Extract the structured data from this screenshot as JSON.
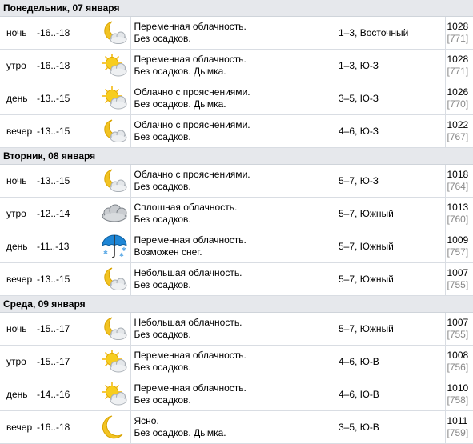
{
  "days": [
    {
      "title": "Понедельник, 07 января",
      "periods": [
        {
          "part": "ночь",
          "temp": "-16..-18",
          "icon": "moon-cloud-icon",
          "desc1": "Переменная облачность.",
          "desc2": "Без осадков.",
          "wind": "1–3, Восточный",
          "p1": "1028",
          "p2": "[771]"
        },
        {
          "part": "утро",
          "temp": "-16..-18",
          "icon": "sun-cloud-icon",
          "desc1": "Переменная облачность.",
          "desc2": "Без осадков. Дымка.",
          "wind": "1–3, Ю-З",
          "p1": "1028",
          "p2": "[771]"
        },
        {
          "part": "день",
          "temp": "-13..-15",
          "icon": "sun-cloud-icon",
          "desc1": "Облачно с прояснениями.",
          "desc2": "Без осадков. Дымка.",
          "wind": "3–5, Ю-З",
          "p1": "1026",
          "p2": "[770]"
        },
        {
          "part": "вечер",
          "temp": "-13..-15",
          "icon": "moon-cloud-icon",
          "desc1": "Облачно с прояснениями.",
          "desc2": "Без осадков.",
          "wind": "4–6, Ю-З",
          "p1": "1022",
          "p2": "[767]"
        }
      ]
    },
    {
      "title": "Вторник, 08 января",
      "periods": [
        {
          "part": "ночь",
          "temp": "-13..-15",
          "icon": "moon-cloud-icon",
          "desc1": "Облачно с прояснениями.",
          "desc2": "Без осадков.",
          "wind": "5–7, Ю-З",
          "p1": "1018",
          "p2": "[764]"
        },
        {
          "part": "утро",
          "temp": "-12..-14",
          "icon": "overcast-icon",
          "desc1": "Сплошная облачность.",
          "desc2": "Без осадков.",
          "wind": "5–7, Южный",
          "p1": "1013",
          "p2": "[760]"
        },
        {
          "part": "день",
          "temp": "-11..-13",
          "icon": "umbrella-snow-icon",
          "desc1": "Переменная облачность.",
          "desc2": "Возможен снег.",
          "wind": "5–7, Южный",
          "p1": "1009",
          "p2": "[757]"
        },
        {
          "part": "вечер",
          "temp": "-13..-15",
          "icon": "moon-cloud-icon",
          "desc1": "Небольшая облачность.",
          "desc2": "Без осадков.",
          "wind": "5–7, Южный",
          "p1": "1007",
          "p2": "[755]"
        }
      ]
    },
    {
      "title": "Среда, 09 января",
      "periods": [
        {
          "part": "ночь",
          "temp": "-15..-17",
          "icon": "moon-cloud-icon",
          "desc1": "Небольшая облачность.",
          "desc2": "Без осадков.",
          "wind": "5–7, Южный",
          "p1": "1007",
          "p2": "[755]"
        },
        {
          "part": "утро",
          "temp": "-15..-17",
          "icon": "sun-cloud-icon",
          "desc1": "Переменная облачность.",
          "desc2": "Без осадков.",
          "wind": "4–6, Ю-В",
          "p1": "1008",
          "p2": "[756]"
        },
        {
          "part": "день",
          "temp": "-14..-16",
          "icon": "sun-cloud-icon",
          "desc1": "Переменная облачность.",
          "desc2": "Без осадков.",
          "wind": "4–6, Ю-В",
          "p1": "1010",
          "p2": "[758]"
        },
        {
          "part": "вечер",
          "temp": "-16..-18",
          "icon": "moon-icon",
          "desc1": "Ясно.",
          "desc2": "Без осадков. Дымка.",
          "wind": "3–5, Ю-В",
          "p1": "1011",
          "p2": "[759]"
        }
      ]
    }
  ],
  "colors": {
    "header_bg": "#e6e8ec",
    "grid": "#d9dde3",
    "mmhg": "#888888",
    "sun": "#f5c518",
    "moon": "#f0c020",
    "cloud": "#e4e7ea"
  }
}
